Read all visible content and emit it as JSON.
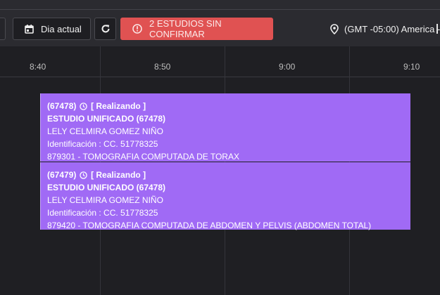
{
  "toolbar": {
    "today_label": "Dia actual",
    "alert_label": "2 ESTUDIOS SIN CONFIRMAR",
    "timezone_label": "(GMT -05:00) America -"
  },
  "icons": {
    "today": "calendar-icon",
    "refresh": "refresh-icon",
    "alert": "info-circle-icon",
    "timezone": "location-pin-icon",
    "status": "clock-icon"
  },
  "timeline": {
    "labels": [
      "8:40",
      "8:50",
      "9:00",
      "9:10"
    ]
  },
  "colors": {
    "event_bg": "#a06af5",
    "alert_bg": "#e05252",
    "background": "#1f1f23"
  },
  "events": [
    {
      "id": "(67478)",
      "status": "[ Realizando ]",
      "title": "ESTUDIO UNIFICADO (67478)",
      "patient": "LELY CELMIRA GOMEZ NIÑO",
      "identification": "Identificación : CC. 51778325",
      "procedure": "879301 - TOMOGRAFIA COMPUTADA DE TORAX"
    },
    {
      "id": "(67479)",
      "status": "[ Realizando ]",
      "title": "ESTUDIO UNIFICADO (67478)",
      "patient": "LELY CELMIRA GOMEZ NIÑO",
      "identification": "Identificación : CC. 51778325",
      "procedure": "879420 - TOMOGRAFIA COMPUTADA DE ABDOMEN Y PELVIS (ABDOMEN TOTAL)"
    }
  ]
}
